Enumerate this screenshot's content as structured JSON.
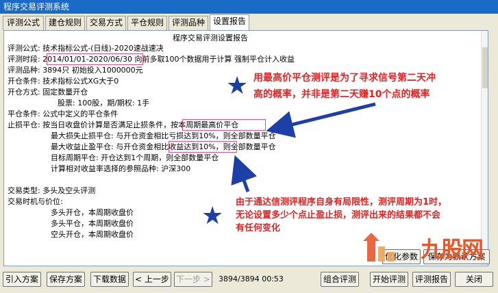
{
  "window": {
    "title": "程序交易评测系统"
  },
  "tabs": [
    {
      "label": "评测公式",
      "active": false
    },
    {
      "label": "建仓规则",
      "active": false
    },
    {
      "label": "交易方式",
      "active": false
    },
    {
      "label": "平仓规则",
      "active": false
    },
    {
      "label": "评测品种",
      "active": false
    },
    {
      "label": "设置报告",
      "active": true
    }
  ],
  "report": {
    "title": "程序交易评测设置报告",
    "lines": [
      "评测公式: 技术指标公式-(日线)-2020速战速决",
      "评测时段: 2014/01/01-2020/06/30 向前多取100个数据用于计算 强制平仓计入收益",
      "评测品种: 3894只 初始投入1000000元",
      "开仓条件: 技术指标公式XG大于0",
      "开仓方式: 固定数量开仓",
      "股票: 100股，期/期权: 1手",
      "平仓条件: 公式中定义的平仓条件",
      "止损平仓: 按当日收盘价计算是否满足止损条件，按本周期最高价平仓",
      "最大损失止损平仓: 与开仓资金相比亏损达到10%，则全部数量平仓",
      "最大收益止盈平仓: 与开仓资金相比收益达到10%，则全部数量平仓",
      "目标周期平仓: 开仓达到1个周期，则全部数量平仓",
      "计算相对收益率选择的参照品种: 沪深300",
      "交易类型: 多头及空头评测",
      "交易时机与价位:",
      "多头开仓，本周期收盘价",
      "多头平仓，本周期收盘价",
      "空头开仓，本周期收盘价"
    ]
  },
  "annotations": {
    "top": [
      "用最高价平仓测评是为了寻求信号第二天冲",
      "高的概率，并非是第二天赚10个点的概率"
    ],
    "bottom": [
      "由于通达信测评程序自身有局限性，测评周期为1时，",
      "无论设置多少个点止盈止损，测评出来的结果都不会",
      "有任何变化"
    ]
  },
  "colors": {
    "annotation_text": "#e62020",
    "arrow": "#1d3fa8",
    "highlight_box": "#e0508a",
    "title_bar": "#1a6bc7"
  },
  "icons": {
    "star": "star-icon",
    "arrow": "arrow-icon"
  },
  "right_buttons": {
    "optimize": "优化参数",
    "save_default": "保存为默认方案"
  },
  "bottom_buttons": {
    "import": "引入方案",
    "save": "保存方案",
    "download": "下载数据",
    "prev": "上一步",
    "next": "下一步",
    "counter": "3894/3894 00:53",
    "combo": "组合评测",
    "start": "开始评测",
    "report": "评测报告",
    "close": "关闭"
  },
  "watermark": {
    "text": "九股网"
  }
}
